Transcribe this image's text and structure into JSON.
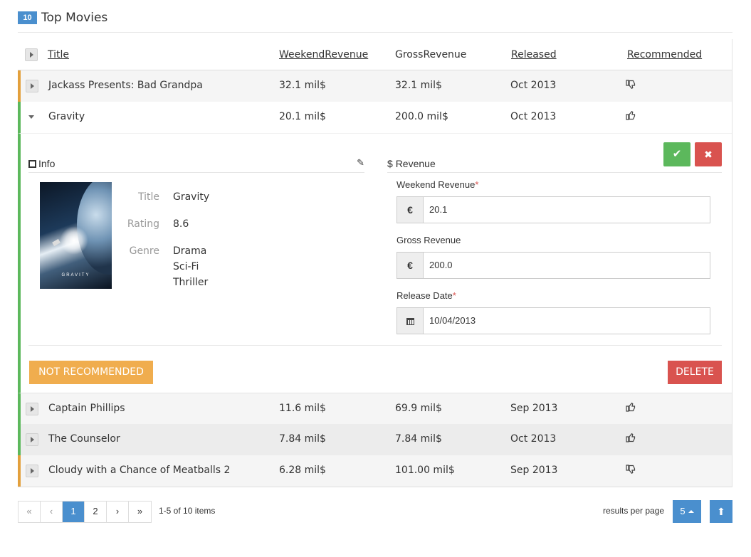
{
  "header": {
    "count": "10",
    "title": "Top Movies"
  },
  "columns": {
    "title": "Title",
    "weekend": "WeekendRevenue",
    "gross": "GrossRevenue",
    "released": "Released",
    "recommended": "Recommended"
  },
  "rows_top": [
    {
      "title": "Jackass Presents: Bad Grandpa",
      "weekend": "32.1 mil$",
      "gross": "32.1 mil$",
      "released": "Oct 2013",
      "recommended": false,
      "icon": "thumbs-down-icon"
    },
    {
      "title": "Gravity",
      "weekend": "20.1 mil$",
      "gross": "200.0 mil$",
      "released": "Oct 2013",
      "recommended": true,
      "icon": "thumbs-up-icon"
    }
  ],
  "detail": {
    "info_title": "Info",
    "revenue_title": "Revenue",
    "revenue_symbol": "$",
    "poster_text": "GRAVITY",
    "labels": {
      "title": "Title",
      "rating": "Rating",
      "genre": "Genre"
    },
    "values": {
      "title": "Gravity",
      "rating": "8.6",
      "genres": [
        "Drama",
        "Sci-Fi",
        "Thriller"
      ]
    },
    "form": {
      "weekend_label": "Weekend Revenue",
      "weekend_value": "20.1",
      "weekend_addon": "€",
      "gross_label": "Gross Revenue",
      "gross_value": "200.0",
      "gross_addon": "€",
      "date_label": "Release Date",
      "date_value": "10/04/2013",
      "required_mark": "*"
    },
    "not_recommended_label": "NOT RECOMMENDED",
    "delete_label": "DELETE"
  },
  "rows_bottom": [
    {
      "title": "Captain Phillips",
      "weekend": "11.6 mil$",
      "gross": "69.9 mil$",
      "released": "Sep 2013",
      "recommended": true,
      "icon": "thumbs-up-icon"
    },
    {
      "title": "The Counselor",
      "weekend": "7.84 mil$",
      "gross": "7.84 mil$",
      "released": "Oct 2013",
      "recommended": true,
      "icon": "thumbs-up-icon"
    },
    {
      "title": "Cloudy with a Chance of Meatballs 2",
      "weekend": "6.28 mil$",
      "gross": "101.00 mil$",
      "released": "Sep 2013",
      "recommended": false,
      "icon": "thumbs-down-icon"
    }
  ],
  "pager": {
    "first": "«",
    "prev": "‹",
    "pages": [
      "1",
      "2"
    ],
    "next": "›",
    "last": "»",
    "info": "1-5 of 10 items",
    "rpp_label": "results per page",
    "rpp_value": "5"
  },
  "colors": {
    "accent": "#4a8fce",
    "success": "#5cb85c",
    "danger": "#d9534f",
    "warning": "#f0ad4e"
  }
}
